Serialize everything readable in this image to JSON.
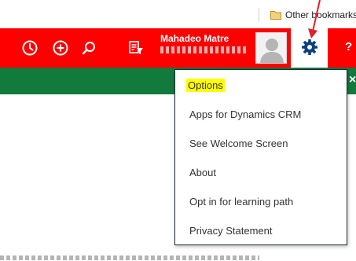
{
  "bookmarks_bar": {
    "other_bookmarks_label": "Other bookmarks"
  },
  "nav_bar": {
    "icons": [
      "recent-icon",
      "create-icon",
      "search-icon",
      "advanced-find-icon"
    ],
    "user_name": "Mahadeo Matre",
    "help_label": "?"
  },
  "notification_bar": {
    "close_label": "×"
  },
  "settings_menu": {
    "items": [
      {
        "label": "Options",
        "highlighted": true
      },
      {
        "label": "Apps for Dynamics CRM"
      },
      {
        "label": "See Welcome Screen"
      },
      {
        "label": "About"
      },
      {
        "label": "Opt in for learning path"
      },
      {
        "label": "Privacy Statement"
      }
    ]
  },
  "colors": {
    "nav_bar": "#ff0000",
    "notification_bar": "#117a3c",
    "highlight": "#ffff00",
    "annotation_arrow": "#e0202a"
  }
}
